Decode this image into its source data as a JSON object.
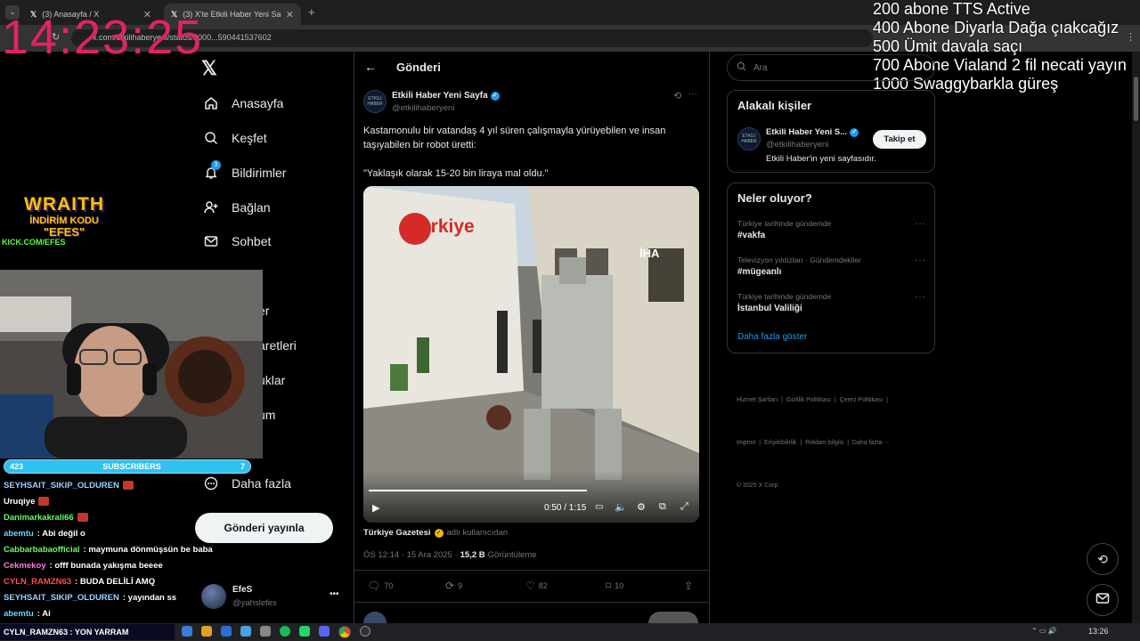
{
  "browser": {
    "tabs": [
      {
        "label": "(3) Anasayfa / X"
      },
      {
        "label": "(3) X'te Etkili Haber Yeni Sayfa:"
      }
    ],
    "url": "x.com/etkilihaberyeni/status/2000...590441537602"
  },
  "overlay": {
    "clock": "14:23:25",
    "goals": [
      "200 abone TTS Active",
      "400 Abone Diyarla Dağa çıakcağız",
      "500 Ümit davala saçı",
      "700 Abone Vialand 2 fil necati yayın",
      "1000 Swaggybarkla güreş"
    ],
    "promo_title": "WRAITH",
    "promo_line2": "İNDİRİM KODU",
    "promo_code": "\"EFES\"",
    "promo_url": "KICK.COM/EFES",
    "sub_count": "423",
    "sub_label": "SUBSCRIBERS",
    "sub_goal": "7",
    "chat": [
      {
        "user": "SEYHSAIT_SIKIP_OLDUREN",
        "text": "",
        "color": "#9ad0ff"
      },
      {
        "user": "Uruqiye",
        "text": "",
        "color": "#ffffff"
      },
      {
        "user": "Danimarkakrali66",
        "text": "",
        "color": "#66ff66"
      },
      {
        "user": "abemtu",
        "text": ": Abi değil o",
        "color": "#6ad1ff"
      },
      {
        "user": "Cabbarbabaofficial",
        "text": ": maymuna dönmüşsün be baba",
        "color": "#66ff66"
      },
      {
        "user": "Cekmekoy",
        "text": ": offf bunada yakışma beeee",
        "color": "#ff7ad9"
      },
      {
        "user": "CYLN_RAMZN63",
        "text": ": BUDA DELİLİ AMQ",
        "color": "#ff4d4d"
      },
      {
        "user": "SEYHSAIT_SIKIP_OLDUREN",
        "text": ": yayından ss",
        "color": "#9ad0ff"
      },
      {
        "user": "abemtu",
        "text": ": Ai",
        "color": "#6ad1ff"
      }
    ],
    "ticker": "CYLN_RAMZN63 : YON YARRAM"
  },
  "sidebar": {
    "items": [
      {
        "label": "Anasayfa",
        "icon": "home-icon"
      },
      {
        "label": "Keşfet",
        "icon": "search-icon"
      },
      {
        "label": "Bildirimler",
        "icon": "bell-icon",
        "badge": "3"
      },
      {
        "label": "Bağlan",
        "icon": "add-person-icon"
      },
      {
        "label": "Sohbet",
        "icon": "mail-icon"
      }
    ],
    "partial_items": [
      "er",
      "aretleri",
      "uklar",
      "um"
    ],
    "more_label": "Daha fazla",
    "post_label": "Gönderi yayınla",
    "account_name": "EfeS",
    "account_handle": "@yahslefes"
  },
  "post": {
    "header_title": "Gönderi",
    "author_name": "Etkili Haber Yeni Sayfa",
    "author_handle": "@etkilihaberyeni",
    "text_line1": "Kastamonulu bir vatandaş 4 yıl süren çalışmayla yürüyebilen ve insan",
    "text_line2": "taşıyabilen bir robot üretti:",
    "quote": "\"Yaklaşık olarak 15-20 bin liraya mal oldu.\"",
    "video_brand": "Türkiye",
    "video_watermark": "İHA",
    "video_time": "0:50 / 1:15",
    "video_progress": 0.67,
    "source_name": "Türkiye Gazetesi",
    "source_suffix": "adlı kullanıcıdan",
    "time": "ÖS 12:14 · 15 Ara 2025 ·",
    "views_count": "15,2 B",
    "views_label": "Görüntüleme",
    "replies": "70",
    "reposts": "9",
    "likes": "82",
    "bookmarks": "10"
  },
  "right": {
    "search_placeholder": "Ara",
    "related_title": "Alakalı kişiler",
    "related_name": "Etkili Haber Yeni S...",
    "related_handle": "@etkilihaberyeni",
    "related_bio": "Etkili Haber'in yeni sayfasıdır.",
    "follow_label": "Takip et",
    "trends_title": "Neler oluyor?",
    "trends": [
      {
        "meta": "Türkiye tarihinde gündemde",
        "name": "#vakfa"
      },
      {
        "meta": "Televizyon yıldızları · Gündemdekiler",
        "name": "#mügeanlı"
      },
      {
        "meta": "Türkiye tarihinde gündemde",
        "name": "İstanbul Valiliği"
      }
    ],
    "show_more": "Daha fazla göster",
    "footer_line1": "Hizmet Şartları  |  Gizlilik Politikası  |  Çerez Politikası  |",
    "footer_line2": "Imprint  |  Erişilebilirlik  |  Reklam bilgisi  |  Daha fazla ···",
    "footer_line3": "© 2025 X Corp."
  },
  "taskbar": {
    "time": "13:26"
  },
  "colors": {
    "verified": "#1d9bf0",
    "clock": "#e0245e",
    "accent": "#1d9bf0"
  }
}
